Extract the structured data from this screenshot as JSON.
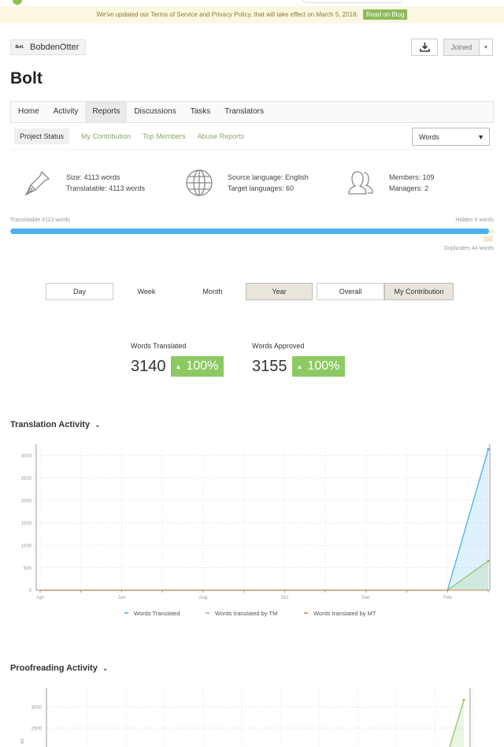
{
  "notice": {
    "text": "We've updated our Terms of Service and Privacy Policy, that will take effect on March 5, 2018.",
    "button": "Read on Blog"
  },
  "header": {
    "logo_text": "Bolt.",
    "username": "BobdenOtter",
    "joined_label": "Joined",
    "project_title": "Bolt"
  },
  "nav": {
    "tabs": [
      "Home",
      "Activity",
      "Reports",
      "Discussions",
      "Tasks",
      "Translators"
    ],
    "active": "Reports"
  },
  "subnav": {
    "items": [
      "Project Status",
      "My Contribution",
      "Top Members",
      "Abuse Reports"
    ],
    "active": "Project Status",
    "select_value": "Words"
  },
  "stats": {
    "size": "Size: 4113 words",
    "translatable": "Translatable: 4113 words",
    "source_language": "Source language: English",
    "target_languages": "Target languages: 60",
    "members": "Members: 109",
    "managers": "Managers: 2"
  },
  "progress": {
    "translatable_label": "Translatable 4113 words",
    "hidden_label": "Hidden 0 words",
    "duplicates_label": "Duplicates 44 words",
    "translatable_fraction": 0.99
  },
  "period": {
    "left": [
      "Day",
      "Week",
      "Month",
      "Year"
    ],
    "left_selected": "Year",
    "right": [
      "Overall",
      "My Contribution"
    ],
    "right_selected": "My Contribution"
  },
  "kpis": [
    {
      "label": "Words Translated",
      "value": "3140",
      "delta": "100%"
    },
    {
      "label": "Words Approved",
      "value": "3155",
      "delta": "100%"
    }
  ],
  "sections": {
    "translation": "Translation Activity",
    "proofreading": "Proofreading Activity"
  },
  "colors": {
    "accent_blue": "#4ab1ed",
    "accent_green": "#8dc963",
    "mt_orange": "#e07b53"
  },
  "chart_data": [
    {
      "type": "area",
      "title": "Translation Activity",
      "x": [
        "Apr",
        "Jun",
        "Aug",
        "Oct",
        "Dec",
        "Feb"
      ],
      "y_ticks": [
        0,
        500,
        1000,
        1500,
        2000,
        2500,
        3000
      ],
      "ylim": [
        0,
        3250
      ],
      "series": [
        {
          "name": "Words Translated",
          "color": "#4ab1ed",
          "points": [
            [
              "Apr",
              0
            ],
            [
              "Feb",
              0
            ],
            [
              "Mar",
              3140
            ]
          ]
        },
        {
          "name": "Words translated by TM",
          "color": "#8dc963",
          "points": [
            [
              "Apr",
              0
            ],
            [
              "Feb",
              0
            ],
            [
              "Mar",
              650
            ]
          ]
        },
        {
          "name": "Words translated by MT",
          "color": "#e07b53",
          "points": [
            [
              "Apr",
              0
            ],
            [
              "Mar",
              0
            ]
          ]
        }
      ],
      "legend": "bottom",
      "grid": true
    },
    {
      "type": "area",
      "title": "Proofreading Activity",
      "y_ticks": [
        2500,
        3000
      ],
      "series": [
        {
          "name": "Words Approved",
          "color": "#8dc963",
          "points": [
            [
              "Mar",
              3155
            ]
          ]
        }
      ],
      "grid": true
    }
  ]
}
